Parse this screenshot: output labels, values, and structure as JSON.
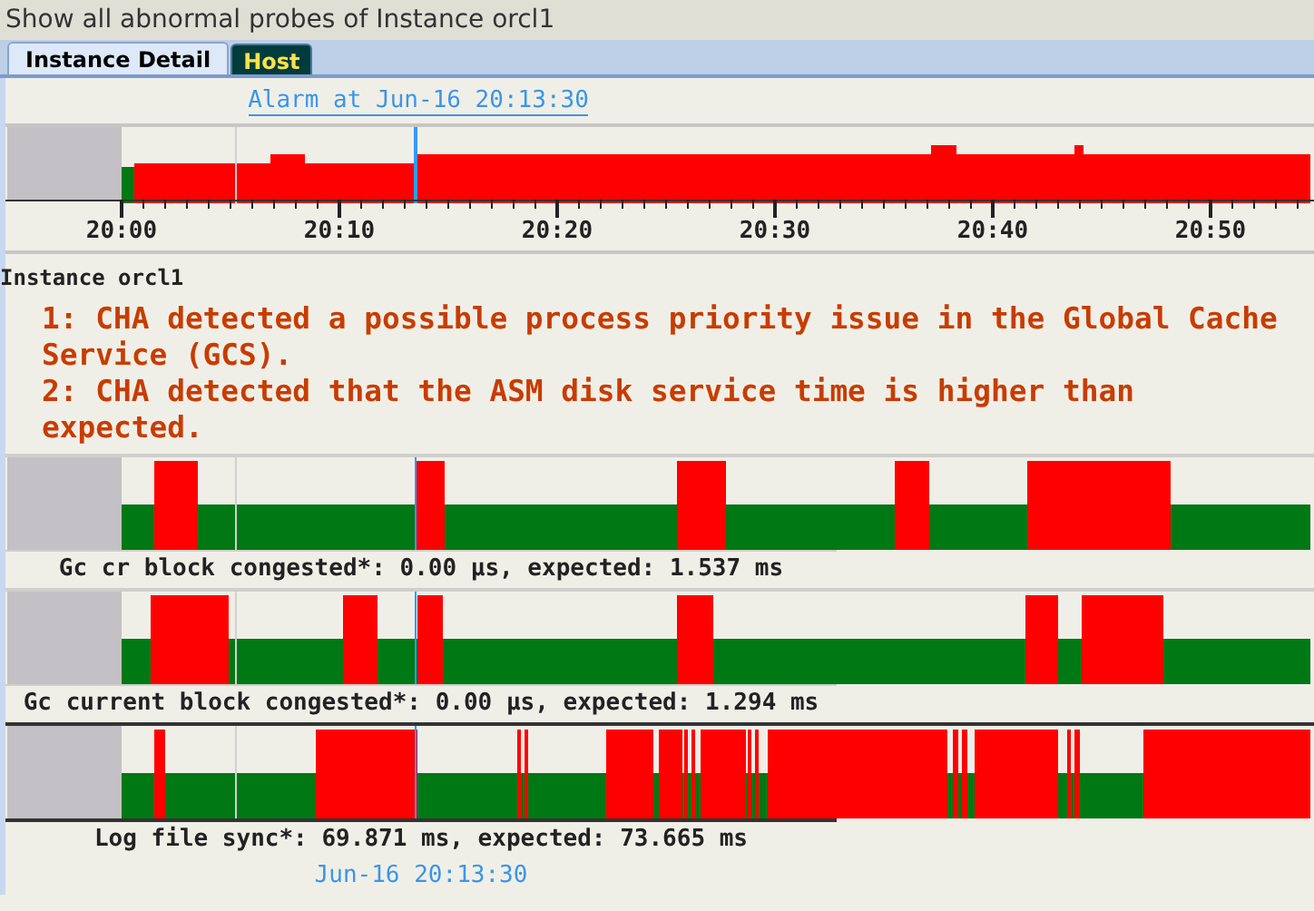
{
  "window": {
    "title": "Show all abnormal probes of Instance orcl1"
  },
  "tabs": [
    {
      "label": "Instance Detail",
      "selected": true
    },
    {
      "label": "Host",
      "selected": false
    }
  ],
  "alarm_link": "Alarm at Jun-16 20:13:30",
  "timeline": {
    "ticks": [
      "20:00",
      "20:10",
      "20:20",
      "20:30",
      "20:40",
      "20:50"
    ]
  },
  "instance_label": "Instance orcl1",
  "messages": [
    "1: CHA detected a possible process priority issue in the Global Cache Service (GCS).",
    "2: CHA detected that the ASM disk service time is higher than expected."
  ],
  "probes": [
    {
      "label": "Gc cr block congested*: 0.00 µs, expected: 1.537 ms"
    },
    {
      "label": "Gc current block congested*: 0.00 µs, expected: 1.294 ms"
    },
    {
      "label": "Log file sync*: 69.871 ms, expected: 73.665 ms"
    }
  ],
  "footer_time": "Jun-16 20:13:30"
}
